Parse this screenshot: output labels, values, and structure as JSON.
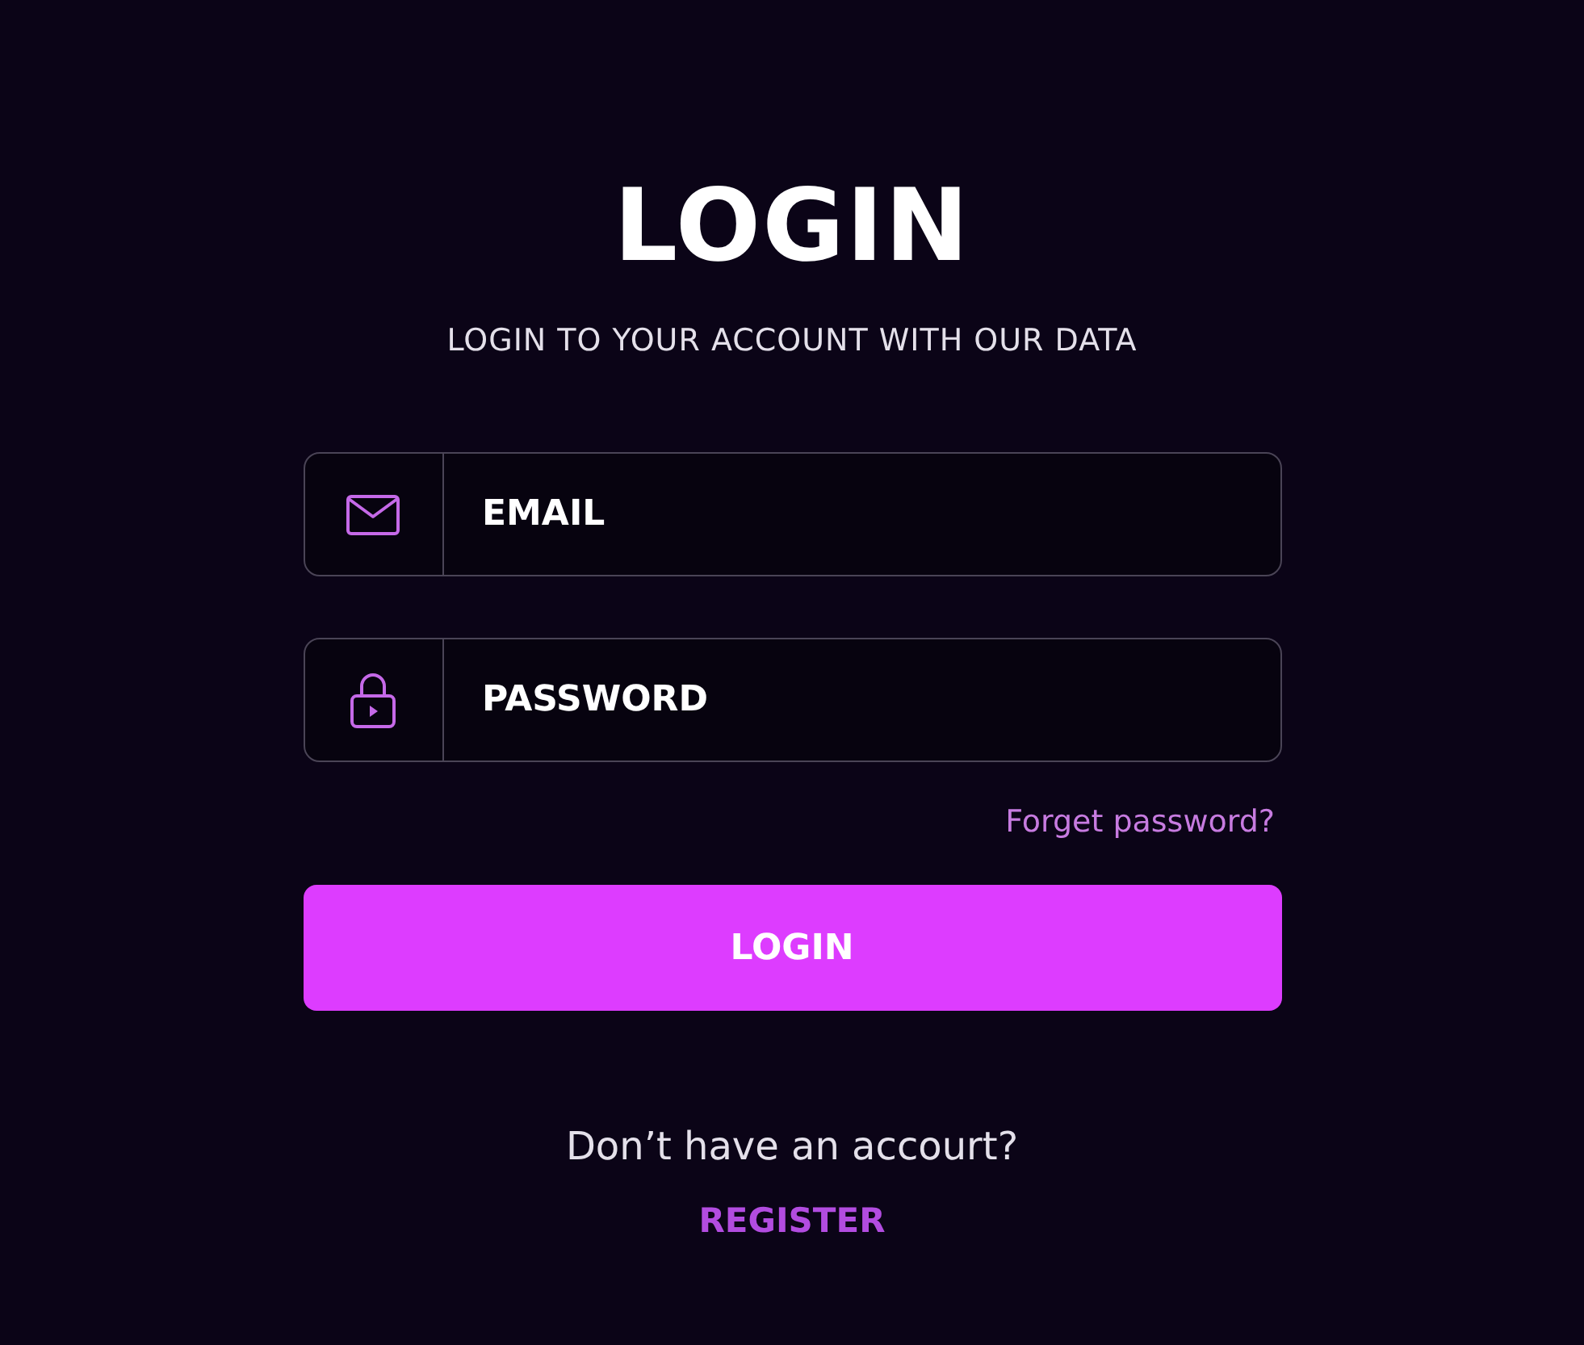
{
  "title": "LOGIN",
  "subtitle": "LOGIN TO YOUR ACCOUNT WITH OUR DATA",
  "fields": [
    {
      "kind": "email",
      "placeholder": "EMAIL"
    },
    {
      "kind": "password",
      "placeholder": "PASSWORD"
    }
  ],
  "forgot_link": "Forget password?",
  "login_button": "LOGIN",
  "signup_prompt": "Don’t have an accourt?",
  "register_link": "REGISTER"
}
